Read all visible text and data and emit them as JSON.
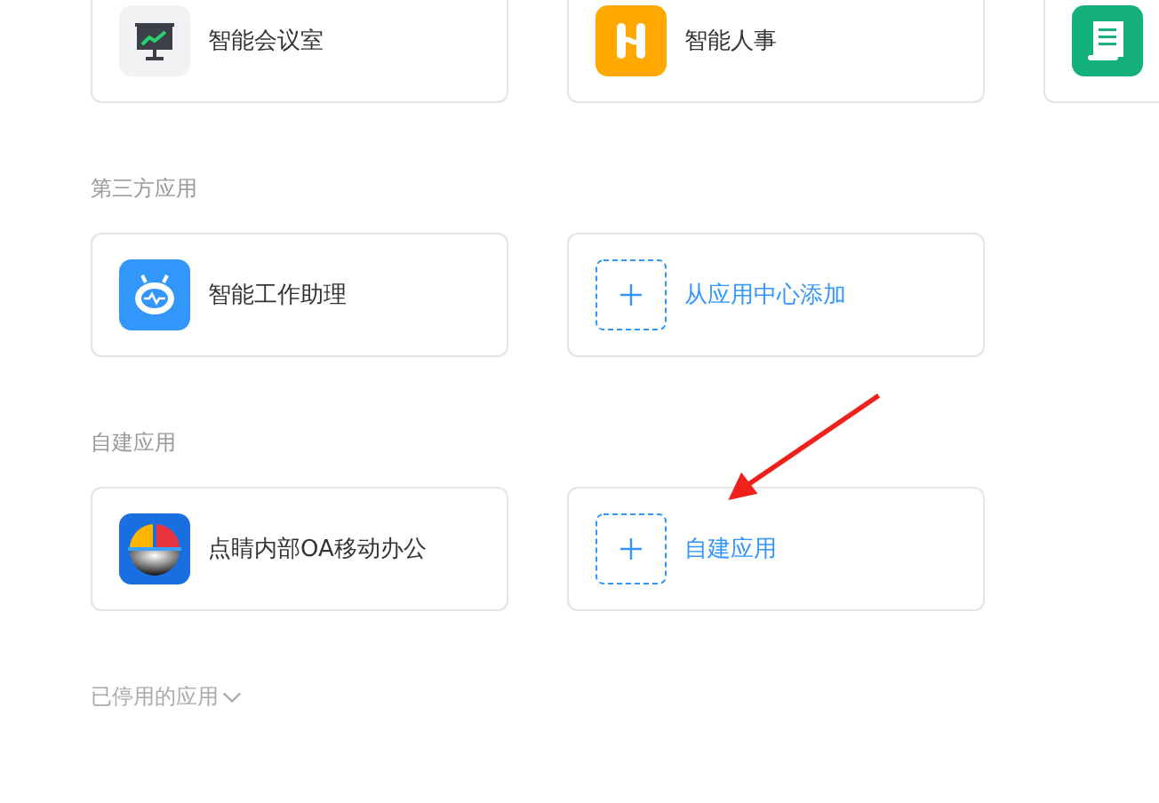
{
  "sections": [
    {
      "apps": [
        {
          "kind": "app",
          "label": "智能会议室"
        },
        {
          "kind": "app",
          "label": "智能人事"
        },
        {
          "kind": "app"
        }
      ]
    },
    {
      "title": "第三方应用",
      "apps": [
        {
          "kind": "app",
          "label": "智能工作助理"
        },
        {
          "kind": "add",
          "label": "从应用中心添加"
        }
      ]
    },
    {
      "title": "自建应用",
      "apps": [
        {
          "kind": "app",
          "label": "点睛内部OA移动办公"
        },
        {
          "kind": "add",
          "label": "自建应用"
        }
      ]
    }
  ],
  "disabled_apps": {
    "label": "已停用的应用",
    "expanded": false
  }
}
